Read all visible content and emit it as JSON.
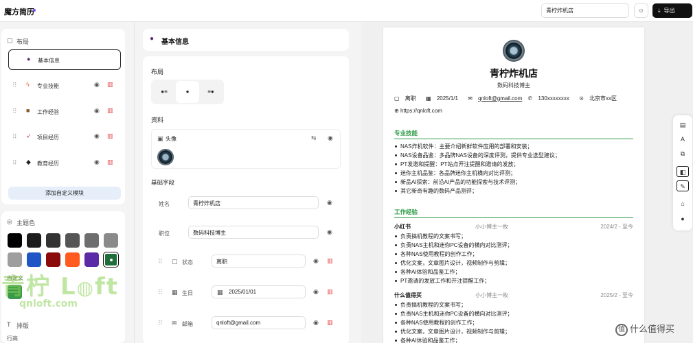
{
  "app": {
    "brand": "魔方简历",
    "title_value": "青柠炸机店",
    "export_label": "导出"
  },
  "left": {
    "layout_label": "布局",
    "items": [
      {
        "label": "基本信息",
        "icon": "person-icon"
      },
      {
        "label": "专业技能",
        "icon": "lightning-icon"
      },
      {
        "label": "工作经验",
        "icon": "briefcase-icon"
      },
      {
        "label": "项目经历",
        "icon": "rocket-icon"
      },
      {
        "label": "教育经历",
        "icon": "graduation-cap-icon"
      }
    ],
    "add_label": "添加自定义模块",
    "theme_label": "主题色",
    "colors": [
      "#000000",
      "#1c1c1c",
      "#333333",
      "#555555",
      "#6e6e6e",
      "#8a8a8a",
      "#9e9e9e",
      "#1f55c4",
      "#8b0a0a",
      "#ff5a1f",
      "#5b2aa6",
      "#1f6e3b"
    ],
    "custom_label": "自定义",
    "custom_color": "#3a9a4a",
    "typography_label": "排版",
    "line_height_label": "行高"
  },
  "mid": {
    "header": "基本信息",
    "layout_label": "布局",
    "profile_label": "资料",
    "avatar_label": "头像",
    "fields_label": "基础字段",
    "fields": [
      {
        "label": "姓名",
        "value": "青柠炸机店"
      },
      {
        "label": "职位",
        "value": "数码科技博主"
      },
      {
        "label": "状态",
        "value": "离职"
      },
      {
        "label": "生日",
        "value": "2025/01/01"
      },
      {
        "label": "邮箱",
        "value": "qnloft@gmail.com"
      }
    ]
  },
  "resume": {
    "name": "青柠炸机店",
    "title": "数码科技博主",
    "status": "离职",
    "birthday": "2025/1/1",
    "email": "qnloft@gmail.com",
    "phone": "130xxxxxxxx",
    "location": "北京市xx区",
    "website": "https://qnloft.com",
    "skills_title": "专业技能",
    "skills": [
      "NAS炸机软件：主要介绍新鲜软件应用的部署和安装；",
      "NAS设备品鉴：多品牌NAS设备的深度评测，提供专业选型建议；",
      "PT发邀和提醒：PT站点开注提醒和邀请的发放；",
      "迷你主机品鉴：各品牌迷你主机横向对比评测；",
      "新品AI探索：前沿AI产品的功能探索与技术评测；",
      "其它新奇有趣的数码产品测评；"
    ],
    "work_title": "工作经验",
    "jobs": [
      {
        "company": "小红书",
        "role": "小小博主一枚",
        "date": "2024/2 - 至今",
        "items": [
          "负责搞机教程的文案书写；",
          "负责NAS主机和迷你PC设备的横向对比测评；",
          "各种NAS使用教程的创作工作；",
          "优化文案，文章图片设计，视频制作与剪辑；",
          "各种AI体验和品鉴工作；",
          "PT邀请的发放工作和开注提醒工作；"
        ]
      },
      {
        "company": "什么值得买",
        "role": "小小博主一枚",
        "date": "2025/2 - 至今",
        "items": [
          "负责搞机教程的文案书写；",
          "负责NAS主机和迷你PC设备的横向对比测评；",
          "各种NAS使用教程的创作工作；",
          "优化文案，文章图片设计，视频制作与剪辑；",
          "各种AI体验和品鉴工作；"
        ]
      }
    ]
  },
  "watermark": {
    "big": "青柠 L ft",
    "small": "qnloft.com"
  },
  "footer_brand": "什么值得买"
}
